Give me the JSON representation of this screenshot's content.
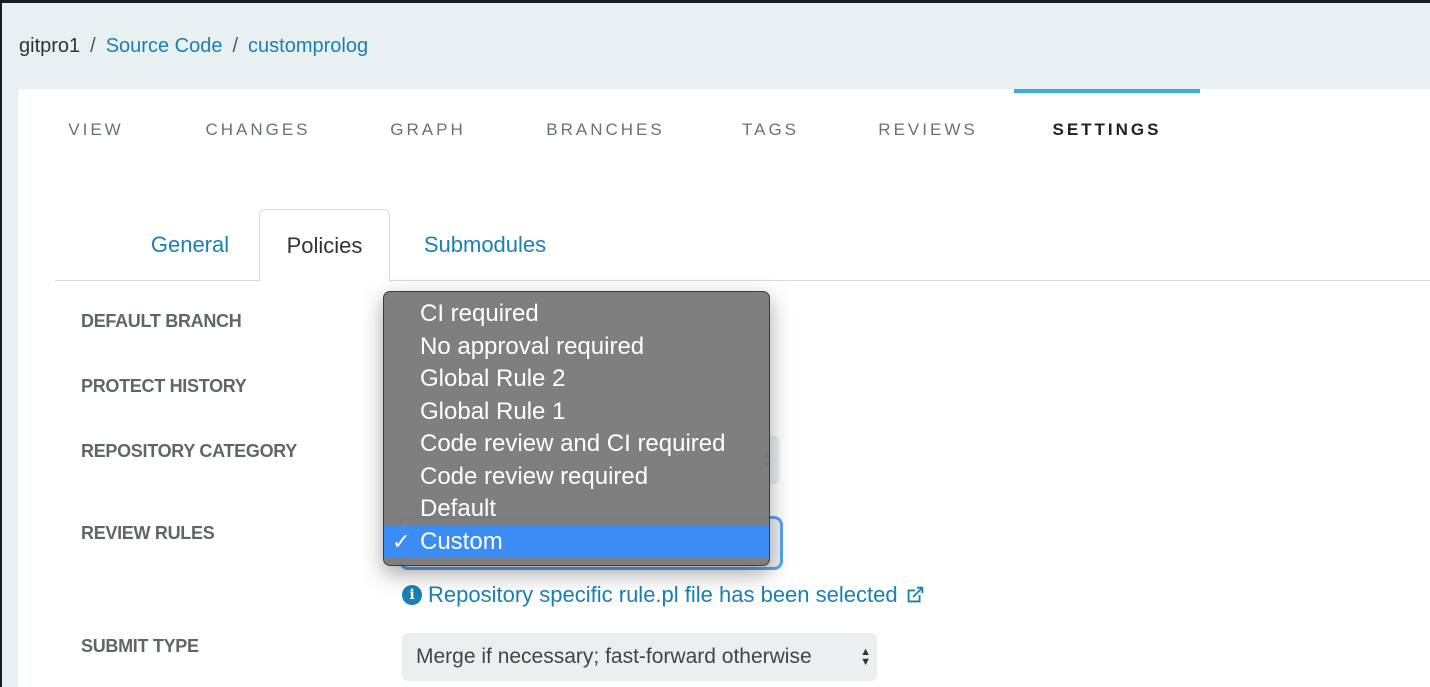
{
  "breadcrumb": {
    "root": "gitpro1",
    "separator": "/",
    "section": "Source Code",
    "repo": "customprolog"
  },
  "main_tabs": [
    {
      "label": "VIEW"
    },
    {
      "label": "CHANGES"
    },
    {
      "label": "GRAPH"
    },
    {
      "label": "BRANCHES"
    },
    {
      "label": "TAGS"
    },
    {
      "label": "REVIEWS"
    },
    {
      "label": "SETTINGS",
      "active": true
    }
  ],
  "sub_tabs": [
    {
      "label": "General"
    },
    {
      "label": "Policies",
      "active": true
    },
    {
      "label": "Submodules"
    }
  ],
  "fields": {
    "default_branch": "DEFAULT BRANCH",
    "protect_history": "PROTECT HISTORY",
    "repository_category": "REPOSITORY CATEGORY",
    "review_rules": "REVIEW RULES",
    "submit_type": "SUBMIT TYPE"
  },
  "info_link": {
    "icon": "info-circle-icon",
    "text": "Repository specific rule.pl file has been selected",
    "trailing_icon": "external-link-icon"
  },
  "submit_type_select": {
    "value": "Merge if necessary; fast-forward otherwise"
  },
  "review_rules_dropdown": {
    "options": [
      "CI required",
      "No approval required",
      "Global Rule 2",
      "Global Rule 1",
      "Code review and CI required",
      "Code review required",
      "Default",
      "Custom"
    ],
    "selected": "Custom",
    "check_mark": "✓"
  },
  "colors": {
    "link": "#1a7fb5",
    "active_tab_border": "#3aaee0",
    "selected_option": "#3b8cf5"
  }
}
